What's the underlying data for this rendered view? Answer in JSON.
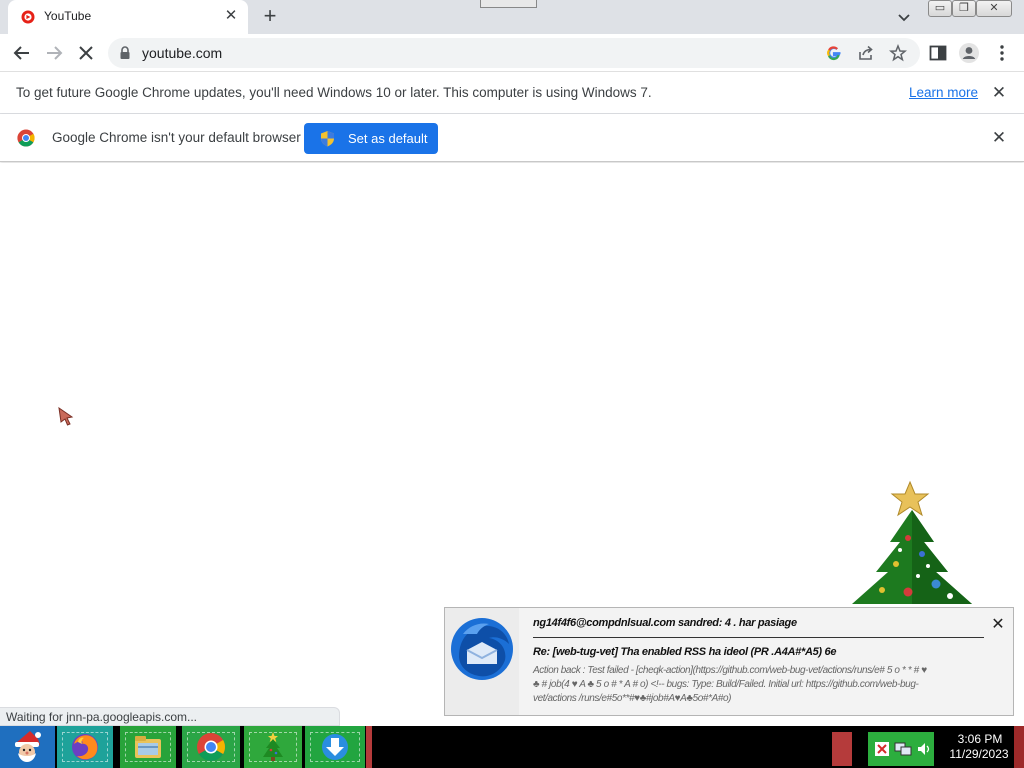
{
  "browser": {
    "tab": {
      "title": "YouTube",
      "close": "✕"
    },
    "new_tab": "+",
    "window_controls": {
      "minimize": "▭",
      "maximize": "❐",
      "close": "✕"
    },
    "address_bar": {
      "url": "youtube.com"
    },
    "loading": true
  },
  "infobars": {
    "update": {
      "message": "To get future Google Chrome updates, you'll need Windows 10 or later. This computer is using Windows 7.",
      "link": "Learn more",
      "close": "✕"
    },
    "default_browser": {
      "message": "Google Chrome isn't your default browser",
      "button": "Set as default",
      "close": "✕"
    }
  },
  "status_bar": "Waiting for jnn-pa.googleapis.com...",
  "notification": {
    "app": "Thunderbird",
    "sender": "ng14f4f6@compdnlsual.com sandred: 4 . har pasiage",
    "subject": "Re: [web-tug-vet] Tha enabled RSS ha ideol (PR  .A4A#*A5)       6e",
    "body": "Action back : Test failed - [cheqk-action](https://github.com/web-bug-vet/actions/runs/e# 5 o * *  # ♥ ♣ # job(4 ♥ A ♣ 5 o # * A # o) <!-- bugs: Type: Build/Failed. Initial url: https://github.com/web-bug-vet/actions /runs/e#5o**#♥♣#job#A♥A♣5o#*A#o)",
    "close": "✕"
  },
  "taskbar": {
    "apps": [
      "Start",
      "Firefox",
      "File Explorer",
      "Chrome",
      "Christmas Tree",
      "Downloader"
    ],
    "clock": {
      "time": "3:06 PM",
      "date": "11/29/2023"
    }
  },
  "colors": {
    "accent": "#1a73e8",
    "tabstrip": "#dee1e6",
    "taskbar": "#000000",
    "taskbar_app_green": "#2aa546"
  }
}
